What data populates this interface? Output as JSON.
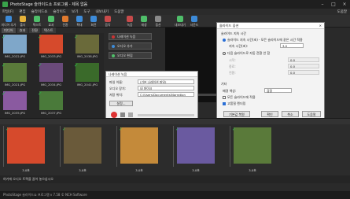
{
  "app": {
    "title": "PhotoStage 슬라이드쇼 프로그램 - 제목 없음"
  },
  "window_controls": [
    "–",
    "□",
    "×"
  ],
  "menu": [
    "파일(F)",
    "편집",
    "슬라이드쇼",
    "슬라이드",
    "보기",
    "도구",
    "내보내기",
    "도움말"
  ],
  "menu_help": "도움말",
  "toolbar": [
    {
      "label": "미디어 추가",
      "color": "#3d8bd8"
    },
    {
      "label": "폴더",
      "color": "#e6b23a"
    },
    {
      "label": "텍스트",
      "color": "#4fbf6a"
    },
    {
      "label": "효과",
      "color": "#4fbf6a"
    },
    {
      "label": "전환",
      "color": "#e07a2e"
    },
    {
      "label": "확대",
      "color": "#3d8bd8"
    },
    {
      "label": "회전",
      "color": "#3d8bd8"
    },
    {
      "label": "음악",
      "color": "#c84a4a"
    },
    {
      "label": "녹음",
      "color": "#c84a4a"
    },
    {
      "label": "재생",
      "color": "#4fbf6a"
    },
    {
      "label": "옵션",
      "color": "#8a8a8a"
    },
    {
      "label": "내보내기",
      "color": "#4fbf6a"
    },
    {
      "label": "사운드",
      "color": "#3d8bd8"
    }
  ],
  "tabs": [
    "미디어",
    "효과",
    "전환",
    "텍스트"
  ],
  "media_items": [
    {
      "caption": "IMG_2022.JPG",
      "color": "#7fa7c9"
    },
    {
      "caption": "IMG_2033.JPG",
      "color": "#d64a2c"
    },
    {
      "caption": "IMG_2021.JPG",
      "color": "#5a7a3a"
    },
    {
      "caption": "IMG_2034.JPG",
      "color": "#6a4a7a"
    },
    {
      "caption": "IMG_2035.JPG",
      "color": "#8a5aa0"
    },
    {
      "caption": "IMG_2037.JPG",
      "color": "#4a7a3a"
    },
    {
      "caption": "IMG_2038.JPG",
      "color": "#6a6a3a"
    },
    {
      "caption": "IMG_2041.JPG",
      "color": "#3a6a2a"
    }
  ],
  "side_buttons": [
    "나레이션 녹음",
    "오디오 추가",
    "오디오 편집"
  ],
  "record_dialog": {
    "title": "나레이션 녹음",
    "row1_label": "파일 이름:",
    "row1_value": "[기본 나레이션 파일]",
    "row2_label": "오디오 장치:",
    "row2_value": "내 마이크",
    "row3_label": "저장 위치:",
    "row3_value": "C:\\Users\\Documents\\Narration",
    "settings_button": "설정...",
    "play_checkbox": "녹음 중 미리 재생"
  },
  "options_dialog": {
    "title": "슬라이드 옵션",
    "section1": "슬라이드 지속 시간",
    "radio1": "슬라이드 지속 시간(초) - 모든 슬라이드에 같은 시간 적용",
    "field1_label": "지속 시간(초):",
    "field1_value": "3.0",
    "radio2": "다음 슬라이드로 자동 전환 안 함",
    "sub1_label": "시작:",
    "sub1_value": "0.0",
    "sub2_label": "종료:",
    "sub2_value": "0.0",
    "sub3_label": "전환:",
    "sub3_value": "0.0",
    "section2": "기타",
    "other_label": "배경 색상:",
    "other_value": "검정",
    "chk1": "모든 슬라이드에 적용",
    "chk2": "고품질 렌더링",
    "buttons": [
      "기본값 복원",
      "확인",
      "취소",
      "도움말"
    ]
  },
  "timeline_clips": [
    {
      "caption": "3.0초",
      "color": "#d64a2c"
    },
    {
      "caption": "3.0초",
      "color": "#6a5a3a"
    },
    {
      "caption": "3.0초",
      "color": "#c48a3a"
    },
    {
      "caption": "3.0초",
      "color": "#6a5aa0"
    },
    {
      "caption": "3.0초",
      "color": "#5a7a3a"
    }
  ],
  "audio_row": "여기에 오디오 트랙을 끌어 놓으십시오",
  "status": "PhotoStage 슬라이드쇼 프로그램 v 7.58 © NCH Software"
}
